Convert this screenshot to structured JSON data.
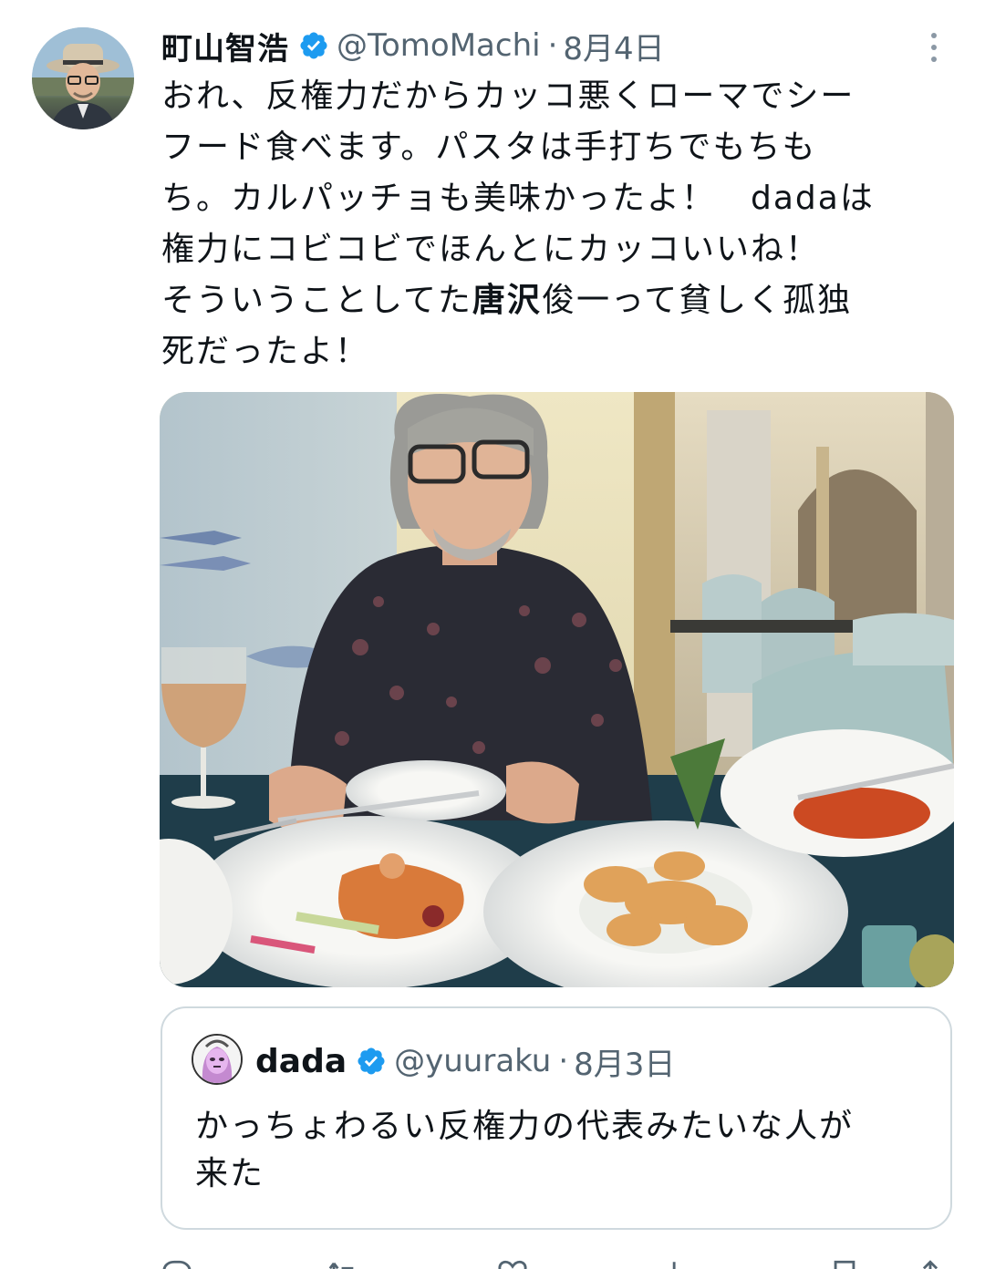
{
  "tweet": {
    "author_name": "町山智浩",
    "author_handle": "@TomoMachi",
    "separator": "·",
    "date": "8月4日",
    "text_lines": [
      {
        "pre": "おれ、反権力だからカッコ悪くローマでシー",
        "bold": "",
        "post": ""
      },
      {
        "pre": "フード食べます。パスタは手打ちでもちも",
        "bold": "",
        "post": ""
      },
      {
        "pre": "ち。カルパッチョも美味かったよ！　dadaは",
        "bold": "",
        "post": ""
      },
      {
        "pre": "権力にコビコビでほんとにカッコいいね！",
        "bold": "",
        "post": ""
      },
      {
        "pre": "そういうことしてた",
        "bold": "唐沢",
        "post": "俊一って貧しく孤独"
      },
      {
        "pre": "死だったよ！",
        "bold": "",
        "post": ""
      }
    ]
  },
  "quote": {
    "author_name": "dada",
    "author_handle": "@yuuraku",
    "separator": "·",
    "date": "8月3日",
    "text_lines": [
      "かっちょわるい反権力の代表みたいな人が",
      "来た"
    ]
  },
  "actions": [
    {
      "icon": "reply-icon",
      "count": ""
    },
    {
      "icon": "retweet-icon",
      "count": ""
    },
    {
      "icon": "like-icon",
      "count": ""
    },
    {
      "icon": "views-icon",
      "count": ""
    },
    {
      "icon": "bookmark-icon",
      "count": ""
    },
    {
      "icon": "share-icon",
      "count": ""
    }
  ],
  "colors": {
    "text": "#0f1419",
    "secondary": "#536471",
    "verified": "#1d9bf0",
    "border": "#cfd9de"
  }
}
